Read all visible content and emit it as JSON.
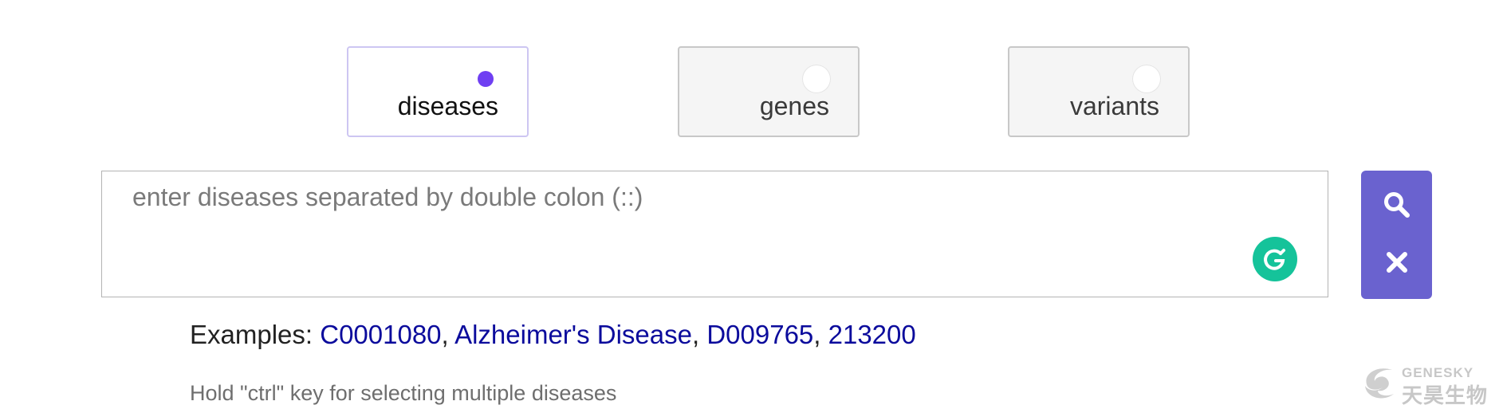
{
  "type_selector": {
    "options": [
      {
        "label": "diseases",
        "selected": true
      },
      {
        "label": "genes",
        "selected": false
      },
      {
        "label": "variants",
        "selected": false
      }
    ],
    "accent_color": "#6f3ff2"
  },
  "search": {
    "placeholder": "enter diseases separated by double colon (::)",
    "value": "",
    "grammarly_icon": "grammarly-icon",
    "search_button_icon": "search-icon",
    "clear_button_icon": "close-icon",
    "button_panel_color": "#6a62cf"
  },
  "examples": {
    "prefix": "Examples:",
    "separator": ",",
    "items": [
      "C0001080",
      "Alzheimer's Disease",
      "D009765",
      "213200"
    ],
    "link_color": "#0b0b9c"
  },
  "hint": "Hold \"ctrl\" key for selecting multiple diseases",
  "watermark": {
    "brand_en": "GENESKY",
    "brand_cn": "天昊生物"
  }
}
